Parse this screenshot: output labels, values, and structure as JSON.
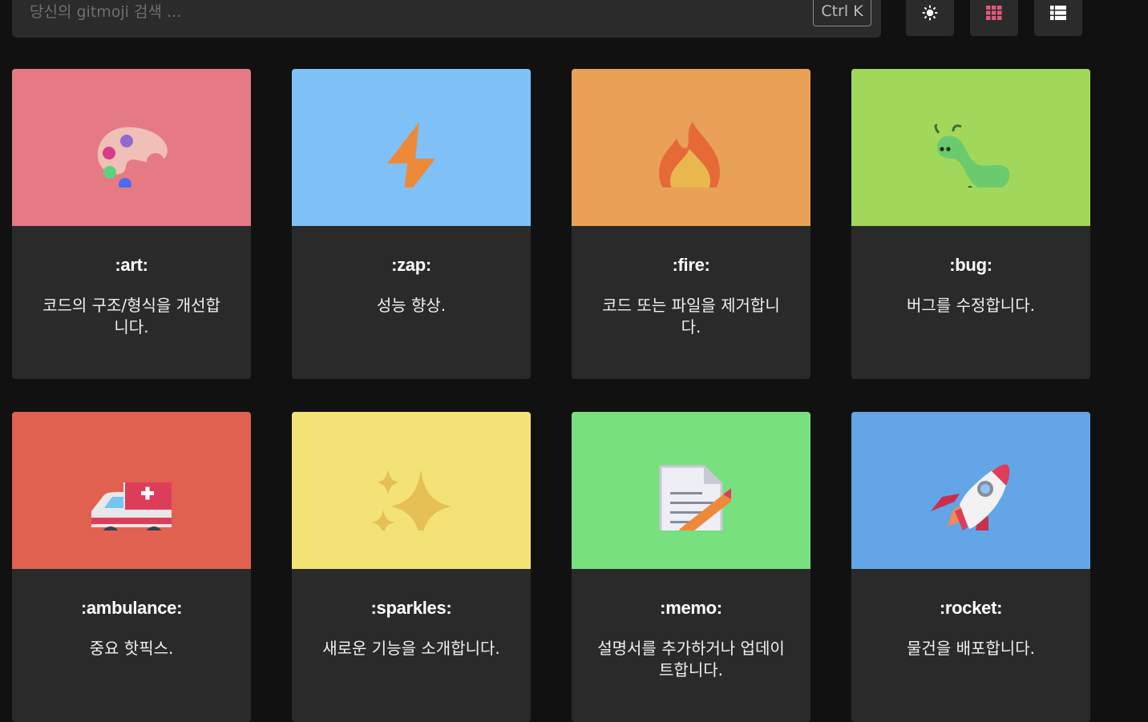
{
  "search": {
    "placeholder": "당신의 gitmoji 검색 ...",
    "shortcut": "Ctrl K"
  },
  "toolbar": {
    "theme_icon": "sun-icon",
    "grid_icon": "grid-icon",
    "list_icon": "list-icon",
    "grid_accent": "#e05a7a"
  },
  "cards": [
    {
      "code": ":art:",
      "description": "코드의 구조/형식을 개선합니다.",
      "color": "#e57a85",
      "icon": "palette-icon"
    },
    {
      "code": ":zap:",
      "description": "성능 향상.",
      "color": "#7fc1f7",
      "icon": "lightning-icon"
    },
    {
      "code": ":fire:",
      "description": "코드 또는 파일을 제거합니다.",
      "color": "#e8a157",
      "icon": "fire-icon"
    },
    {
      "code": ":bug:",
      "description": "버그를 수정합니다.",
      "color": "#a1d85c",
      "icon": "bug-icon"
    },
    {
      "code": ":ambulance:",
      "description": "중요 핫픽스.",
      "color": "#e06150",
      "icon": "ambulance-icon"
    },
    {
      "code": ":sparkles:",
      "description": "새로운 기능을 소개합니다.",
      "color": "#f3e377",
      "icon": "sparkles-icon"
    },
    {
      "code": ":memo:",
      "description": "설명서를 추가하거나 업데이트합니다.",
      "color": "#78e07f",
      "icon": "memo-icon"
    },
    {
      "code": ":rocket:",
      "description": "물건을 배포합니다.",
      "color": "#62a6e8",
      "icon": "rocket-icon"
    }
  ]
}
